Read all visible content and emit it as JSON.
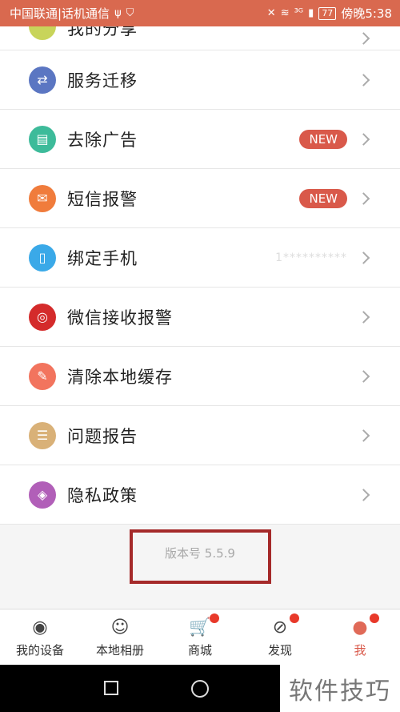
{
  "status_bar": {
    "carrier": "中国联通|话机通信",
    "usb_icon": "ψ",
    "shield_icon": "shield-icon",
    "network": "³ᴳ",
    "battery": "77",
    "time": "傍晚5:38"
  },
  "menu": {
    "partial_label": "我的分享",
    "items": [
      {
        "label": "服务迁移",
        "icon": "transfer-icon",
        "color": "#5b76c2",
        "glyph": "⇄"
      },
      {
        "label": "去除广告",
        "icon": "ad-icon",
        "color": "#3dbb9a",
        "glyph": "▤",
        "badge": "NEW"
      },
      {
        "label": "短信报警",
        "icon": "sms-icon",
        "color": "#f07c3c",
        "glyph": "✉",
        "badge": "NEW"
      },
      {
        "label": "绑定手机",
        "icon": "phone-icon",
        "color": "#3aa9e8",
        "glyph": "▯",
        "masked_value": "1**********"
      },
      {
        "label": "微信接收报警",
        "icon": "wechat-icon",
        "color": "#d42b2b",
        "glyph": "◎"
      },
      {
        "label": "清除本地缓存",
        "icon": "broom-icon",
        "color": "#f2745e",
        "glyph": "✎"
      },
      {
        "label": "问题报告",
        "icon": "report-icon",
        "color": "#d9b178",
        "glyph": "☰"
      },
      {
        "label": "隐私政策",
        "icon": "privacy-icon",
        "color": "#b15fb8",
        "glyph": "◈"
      }
    ]
  },
  "version": "版本号 5.5.9",
  "tabs": [
    {
      "label": "我的设备",
      "icon": "camera-icon",
      "glyph": "◉",
      "dot": false
    },
    {
      "label": "本地相册",
      "icon": "album-icon",
      "glyph": "☺",
      "dot": false
    },
    {
      "label": "商城",
      "icon": "cart-icon",
      "glyph": "🛒",
      "dot": true
    },
    {
      "label": "发现",
      "icon": "compass-icon",
      "glyph": "⊘",
      "dot": true
    },
    {
      "label": "我",
      "icon": "person-icon",
      "glyph": "●",
      "dot": true,
      "active": true
    }
  ],
  "watermark": "软件技巧",
  "colors": {
    "accent": "#d9594a",
    "status_bar": "#d9694f",
    "highlight_border": "#a52a2a"
  }
}
